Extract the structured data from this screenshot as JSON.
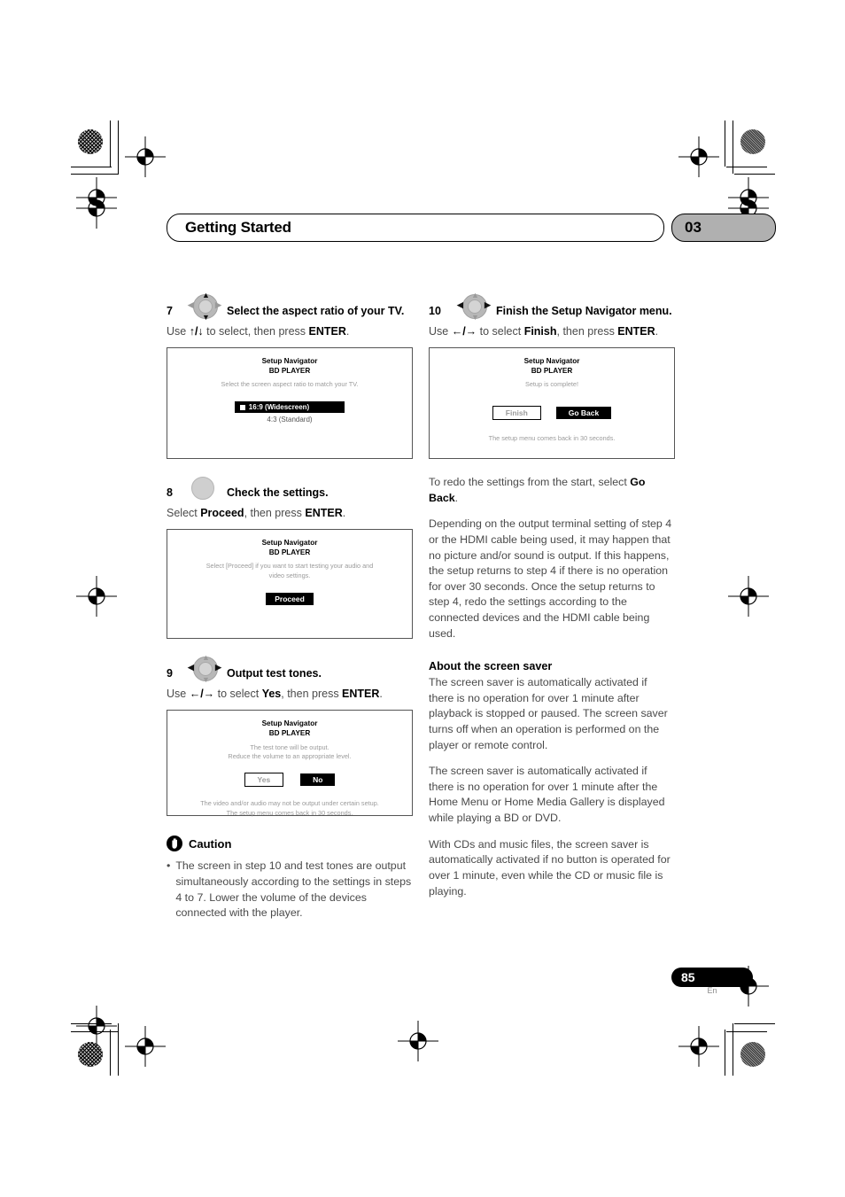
{
  "header": {
    "title": "Getting Started",
    "chapter": "03"
  },
  "footer": {
    "page_number": "85",
    "language": "En"
  },
  "left_column": {
    "step7": {
      "number": "7",
      "title": "Select the aspect ratio of your TV.",
      "instruction_pre": "Use ",
      "instruction_keys": "↑/↓",
      "instruction_mid": " to select, then press ",
      "instruction_key": "ENTER",
      "instruction_end": ".",
      "screen": {
        "title1": "Setup Navigator",
        "title2": "BD PLAYER",
        "desc": "Select the screen aspect ratio to match your TV.",
        "option_selected": "16:9 (Widescreen)",
        "option_other": "4:3 (Standard)"
      }
    },
    "step8": {
      "number": "8",
      "title": "Check the settings.",
      "instruction_pre": "Select ",
      "instruction_bold": "Proceed",
      "instruction_mid": ", then press ",
      "instruction_key": "ENTER",
      "instruction_end": ".",
      "screen": {
        "title1": "Setup Navigator",
        "title2": "BD PLAYER",
        "desc": "Select [Proceed] if you want to start testing your audio and video settings.",
        "button": "Proceed"
      }
    },
    "step9": {
      "number": "9",
      "title": "Output test tones.",
      "instruction_pre": "Use ",
      "instruction_keys": "←/→",
      "instruction_mid": " to select ",
      "instruction_bold": "Yes",
      "instruction_mid2": ", then press ",
      "instruction_key": "ENTER",
      "instruction_end": ".",
      "screen": {
        "title1": "Setup Navigator",
        "title2": "BD PLAYER",
        "desc_line1": "The test tone will be output.",
        "desc_line2": "Reduce the volume to an appropriate level.",
        "button_yes": "Yes",
        "button_no": "No",
        "foot_line1": "The video and/or audio may not be output under certain setup.",
        "foot_line2": "The setup menu comes back in 30 seconds."
      }
    },
    "caution": {
      "heading": "Caution",
      "bullet_marker": "•",
      "bullet_text": "The screen in step 10 and test tones are output simultaneously according to the settings in steps 4 to 7. Lower the volume of the devices connected with the player."
    }
  },
  "right_column": {
    "step10": {
      "number": "10",
      "title": "Finish the Setup Navigator menu.",
      "instruction_pre": "Use ",
      "instruction_keys": "←/→",
      "instruction_mid": " to select ",
      "instruction_bold": "Finish",
      "instruction_mid2": ", then press ",
      "instruction_key": "ENTER",
      "instruction_end": ".",
      "screen": {
        "title1": "Setup Navigator",
        "title2": "BD PLAYER",
        "desc": "Setup is complete!",
        "button_finish": "Finish",
        "button_goback": "Go Back",
        "foot": "The setup menu comes back in 30 seconds."
      }
    },
    "para_redo_pre": "To redo the settings from the start, select ",
    "para_redo_bold": "Go Back",
    "para_redo_end": ".",
    "para_depending": "Depending on the output terminal setting of step 4 or the HDMI cable being used, it may happen that no picture and/or sound is output. If this happens, the setup returns to step 4 if there is no operation for over 30 seconds. Once the setup returns to step 4, redo the settings according to the connected devices and the HDMI cable being used.",
    "screen_saver": {
      "heading": "About the screen saver",
      "para1": "The screen saver is automatically activated if there is no operation for over 1 minute after playback is stopped or paused. The screen saver turns off when an operation is performed on the player or remote control.",
      "para2": "The screen saver is automatically activated if there is no operation for over 1 minute after the Home Menu or Home Media Gallery is displayed while playing a BD or DVD.",
      "para3": "With CDs and music files, the screen saver is automatically activated if no button is operated for over 1 minute, even while the CD or music file is playing."
    }
  },
  "icons": {
    "dpad": "dpad-icon",
    "round_button": "round-button-icon",
    "caution": "caution-hand-icon"
  }
}
